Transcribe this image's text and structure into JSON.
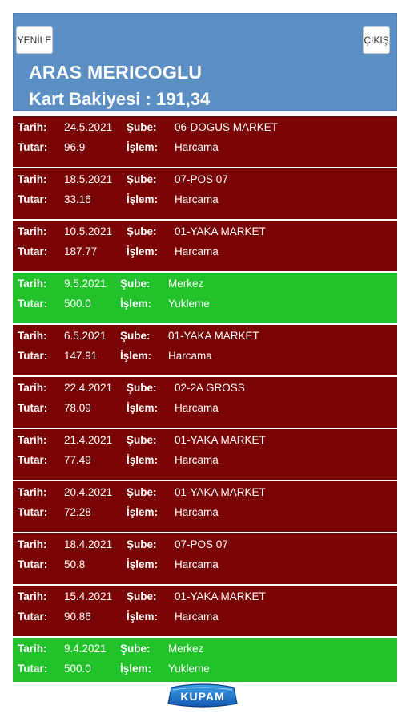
{
  "header": {
    "refresh_label": "YENİLE",
    "exit_label": "ÇIKIŞ",
    "customer_name": "ARAS MERICOGLU",
    "balance_label": "Kart Bakiyesi : 191,34"
  },
  "labels": {
    "date": "Tarih:",
    "branch": "Şube:",
    "amount": "Tutar:",
    "operation": "İşlem:"
  },
  "transactions": [
    {
      "date": "24.5.2021",
      "branch": "06-DOGUS MARKET",
      "amount": "96.9",
      "operation": "Harcama",
      "type": "spend"
    },
    {
      "date": "18.5.2021",
      "branch": "07-POS 07",
      "amount": "33.16",
      "operation": "Harcama",
      "type": "spend"
    },
    {
      "date": "10.5.2021",
      "branch": "01-YAKA MARKET",
      "amount": "187.77",
      "operation": "Harcama",
      "type": "spend"
    },
    {
      "date": "9.5.2021",
      "branch": "Merkez",
      "amount": "500.0",
      "operation": "Yukleme",
      "type": "load"
    },
    {
      "date": "6.5.2021",
      "branch": "01-YAKA MARKET",
      "amount": "147.91",
      "operation": "Harcama",
      "type": "spend"
    },
    {
      "date": "22.4.2021",
      "branch": "02-2A GROSS",
      "amount": "78.09",
      "operation": "Harcama",
      "type": "spend"
    },
    {
      "date": "21.4.2021",
      "branch": "01-YAKA MARKET",
      "amount": "77.49",
      "operation": "Harcama",
      "type": "spend"
    },
    {
      "date": "20.4.2021",
      "branch": "01-YAKA MARKET",
      "amount": "72.28",
      "operation": "Harcama",
      "type": "spend"
    },
    {
      "date": "18.4.2021",
      "branch": "07-POS 07",
      "amount": "50.8",
      "operation": "Harcama",
      "type": "spend"
    },
    {
      "date": "15.4.2021",
      "branch": "01-YAKA MARKET",
      "amount": "90.86",
      "operation": "Harcama",
      "type": "spend"
    },
    {
      "date": "9.4.2021",
      "branch": "Merkez",
      "amount": "500.0",
      "operation": "Yukleme",
      "type": "load"
    }
  ],
  "footer": {
    "logo_text": "KUPAM"
  },
  "colors": {
    "header_bg": "#5b8fc4",
    "spend_bg": "#7a0303",
    "load_bg": "#22c22b"
  }
}
